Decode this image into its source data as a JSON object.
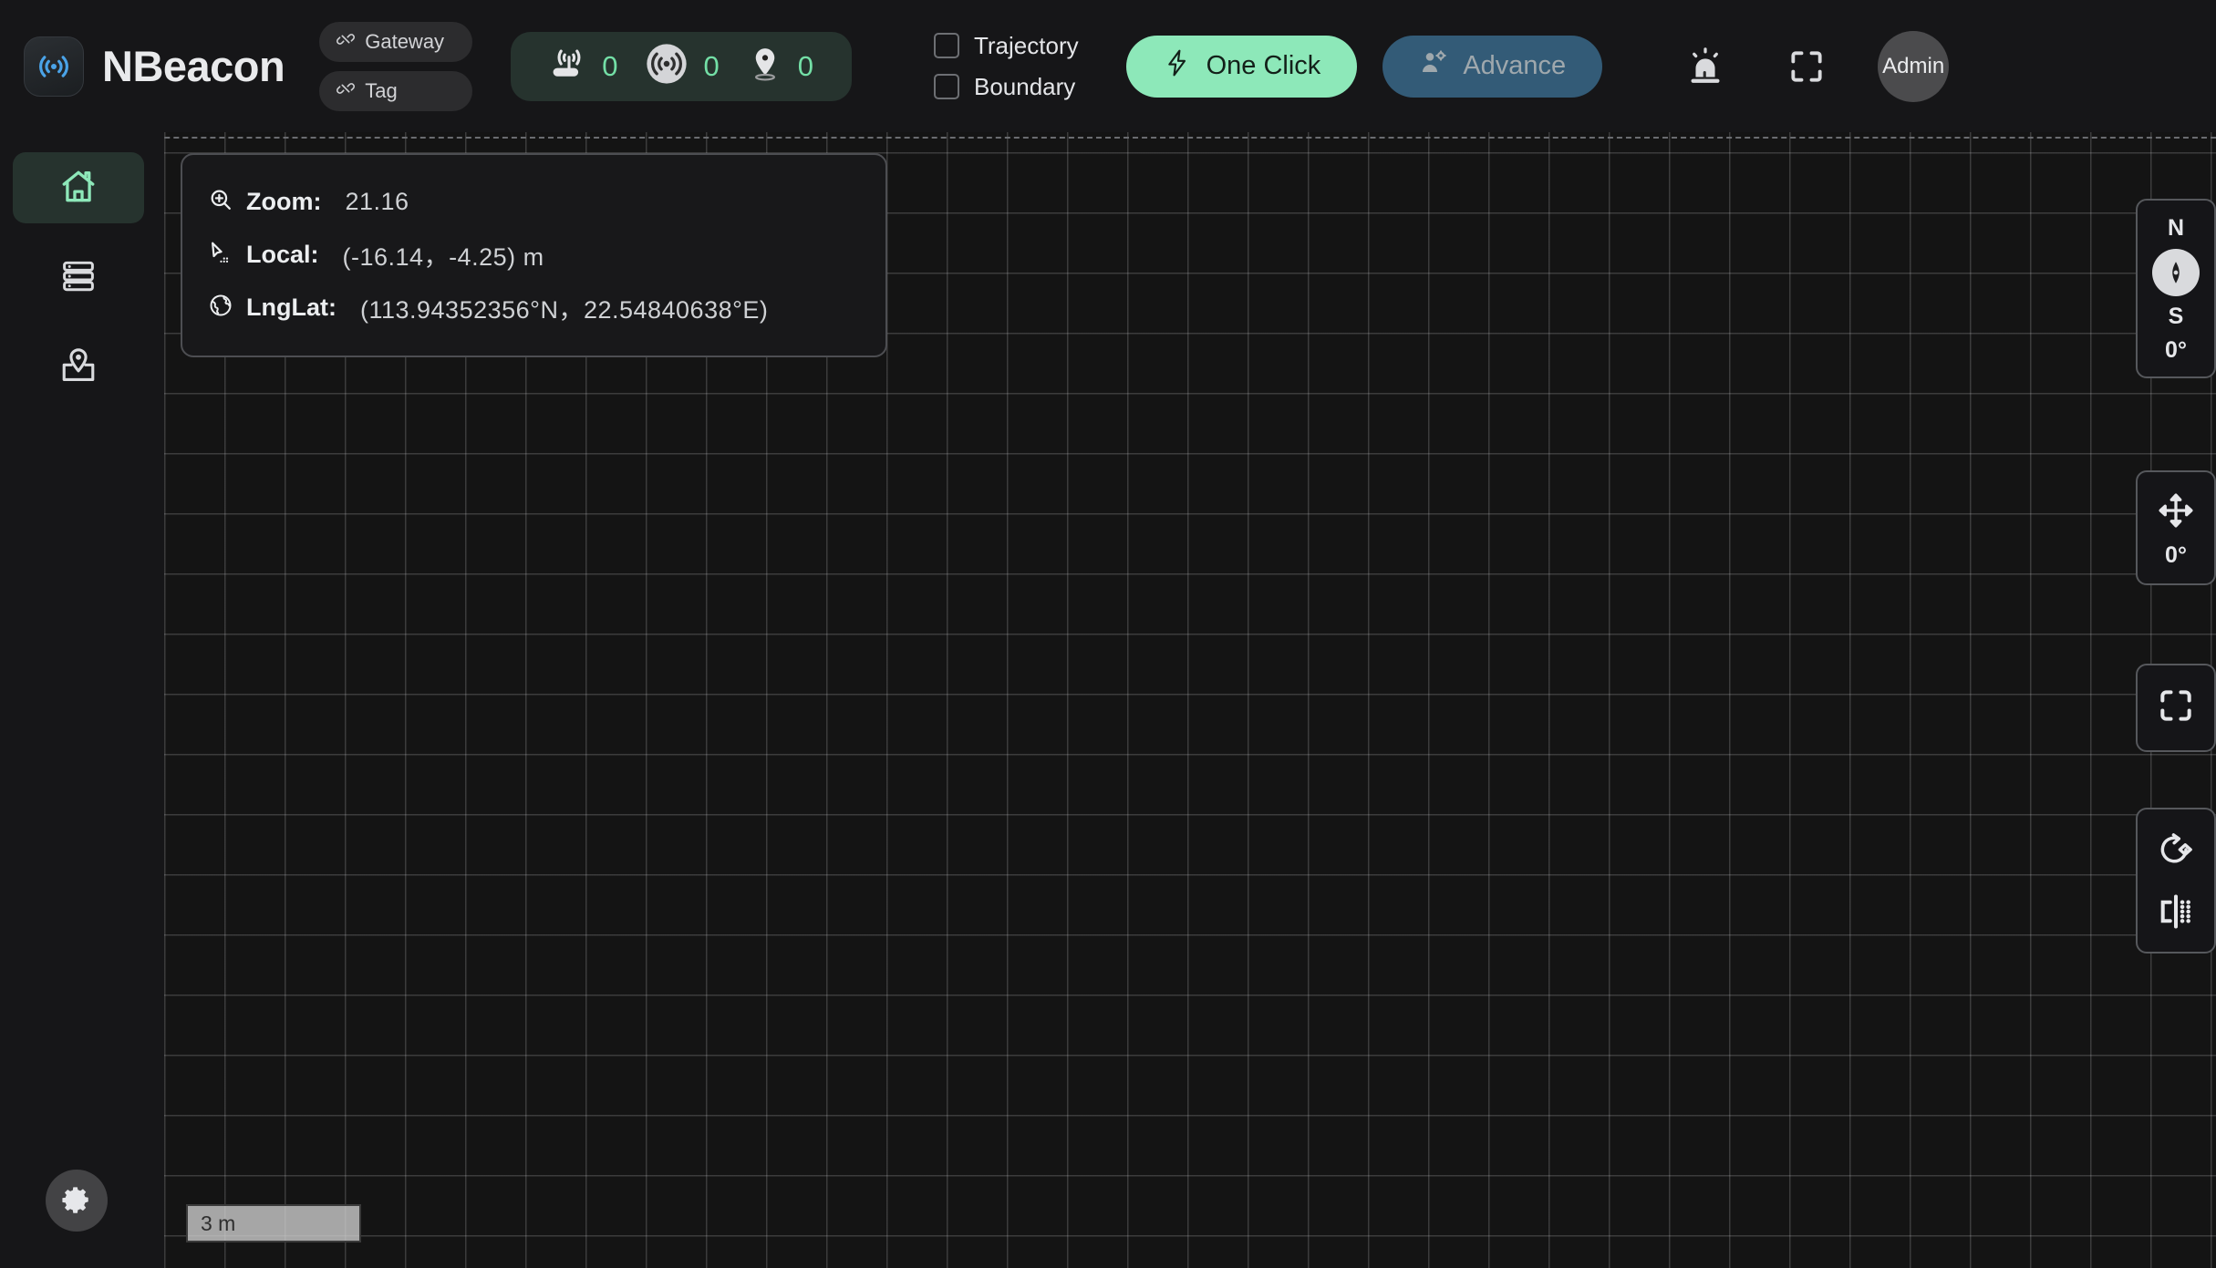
{
  "app": {
    "title": "NBeacon",
    "logo_icon": "beacon-signal-icon"
  },
  "header": {
    "chips": [
      {
        "label": "Gateway",
        "icon": "unlink-icon"
      },
      {
        "label": "Tag",
        "icon": "unlink-icon"
      }
    ],
    "counters": [
      {
        "icon": "router-icon",
        "value": "0"
      },
      {
        "icon": "anchor-signal-icon",
        "value": "0"
      },
      {
        "icon": "map-pin-icon",
        "value": "0"
      }
    ],
    "checkboxes": [
      {
        "label": "Trajectory",
        "checked": false
      },
      {
        "label": "Boundary",
        "checked": false
      }
    ],
    "one_click_label": "One Click",
    "one_click_icon": "lightning-bolt-icon",
    "advance_label": "Advance",
    "advance_icon": "user-gear-icon",
    "icons": [
      {
        "name": "alarm-light-icon"
      },
      {
        "name": "fullscreen-icon"
      }
    ],
    "avatar_label": "Admin"
  },
  "sidebar": {
    "items": [
      {
        "icon": "home-icon",
        "name": "home",
        "active": true
      },
      {
        "icon": "server-rack-icon",
        "name": "devices",
        "active": false
      },
      {
        "icon": "map-location-icon",
        "name": "map",
        "active": false
      }
    ],
    "settings_icon": "gear-icon"
  },
  "info_panel": {
    "rows": [
      {
        "icon": "zoom-in-icon",
        "key": "Zoom:",
        "value": "21.16"
      },
      {
        "icon": "cursor-icon",
        "key": "Local:",
        "value": "(-16.14，-4.25) m"
      },
      {
        "icon": "globe-icon",
        "key": "LngLat:",
        "value": "(113.94352356°N，22.54840638°E)"
      }
    ]
  },
  "map_controls": {
    "compass": {
      "north_label": "N",
      "south_label": "S",
      "angle_label": "0°",
      "dial_icon": "compass-needle-icon"
    },
    "pan": {
      "icon": "move-arrows-icon",
      "angle_label": "0°"
    },
    "fit": {
      "icon": "fit-screen-icon"
    },
    "tools": [
      {
        "icon": "rotate-shape-icon"
      },
      {
        "icon": "align-vertical-icon"
      }
    ]
  },
  "scale_bar": {
    "label": "3 m"
  },
  "colors": {
    "accent_green": "#8de8b9",
    "counter_value": "#73dfa6",
    "advance_blue": "#335b77",
    "panel_bg": "#18181a",
    "header_bg": "#161618",
    "map_bg": "#141414"
  }
}
